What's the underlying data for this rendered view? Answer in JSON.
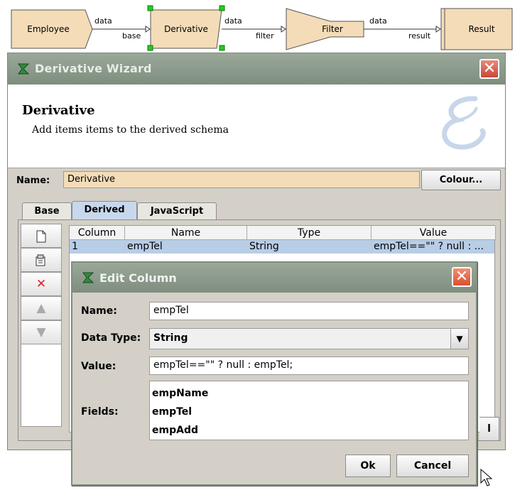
{
  "flow": {
    "nodes": [
      "Employee",
      "Derivative",
      "Filter",
      "Result"
    ],
    "ports": {
      "emp_out": "data",
      "deriv_in": "base",
      "deriv_out": "data",
      "filter_in": "filter",
      "filter_out": "data",
      "result_in": "result"
    },
    "node_fill": "#f4dcb8"
  },
  "wizard": {
    "title": "Derivative Wizard",
    "close_glyph": "✕",
    "heading": "Derivative",
    "subheading": "Add items items to the derived schema",
    "name_label": "Name:",
    "name_value": "Derivative",
    "colour_button": "Colour...",
    "tabs": [
      "Base",
      "Derived",
      "JavaScript"
    ],
    "active_tab": "Derived",
    "table": {
      "headers": [
        "Column",
        "Name",
        "Type",
        "Value"
      ],
      "rows": [
        {
          "column": "1",
          "name": "empTel",
          "type": "String",
          "value": "empTel==\"\" ? null : ..."
        }
      ]
    },
    "tools": [
      "new-icon",
      "edit-icon",
      "delete-icon",
      "up-arrow-icon",
      "down-arrow-icon"
    ],
    "finish_stub": "l",
    "titlebar_color": "#8a9a8a"
  },
  "edit_dialog": {
    "title": "Edit Column",
    "close_glyph": "✕",
    "name_label": "Name:",
    "name_value": "empTel",
    "type_label": "Data Type:",
    "type_value": "String",
    "value_label": "Value:",
    "value_value": "empTel==\"\" ? null : empTel;",
    "fields_label": "Fields:",
    "fields": [
      "empName",
      "empTel",
      "empAdd"
    ],
    "ok_button": "Ok",
    "cancel_button": "Cancel"
  }
}
